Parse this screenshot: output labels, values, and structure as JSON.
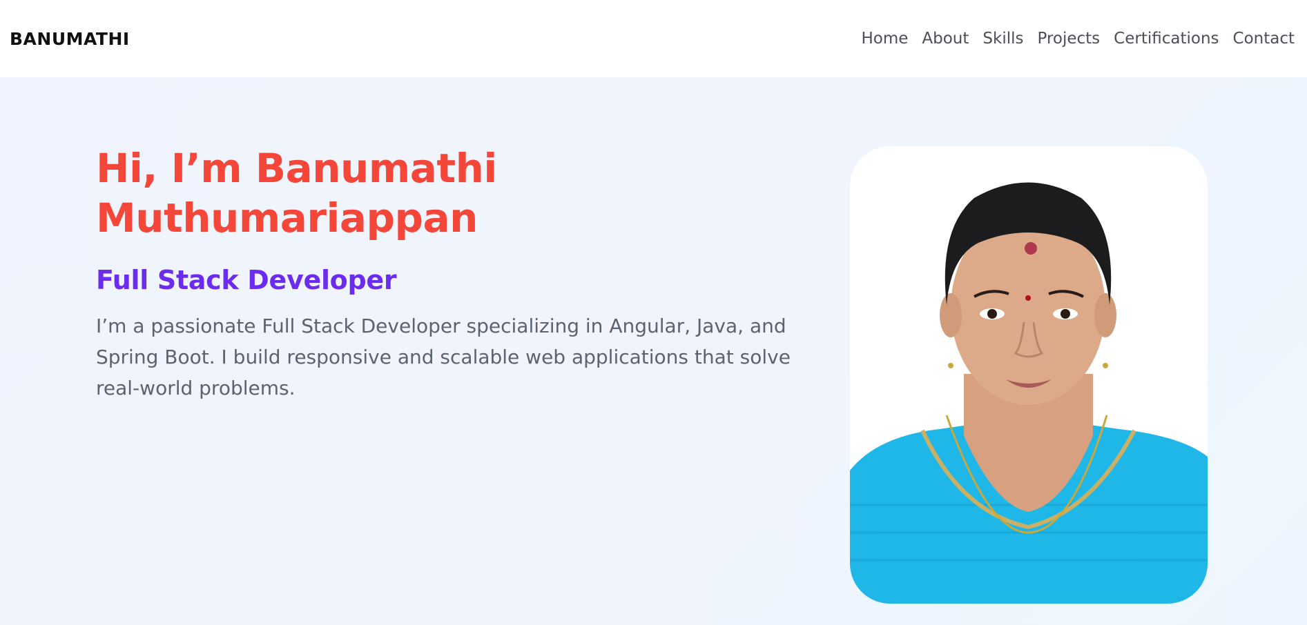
{
  "header": {
    "brand": "BANUMATHI",
    "nav": [
      {
        "label": "Home"
      },
      {
        "label": "About"
      },
      {
        "label": "Skills"
      },
      {
        "label": "Projects"
      },
      {
        "label": "Certifications"
      },
      {
        "label": "Contact"
      }
    ]
  },
  "hero": {
    "title_line1": "Hi, I’m Banumathi",
    "title_line2": "Muthumariappan",
    "role": "Full Stack Developer",
    "description": "I’m a passionate Full Stack Developer specializing in Angular, Java, and Spring Boot. I build responsive and scalable web applications that solve real-world problems."
  },
  "photo": {
    "icon": "profile-photo"
  },
  "colors": {
    "title": "#f4473a",
    "role": "#6b2cf0",
    "text": "#5b6270",
    "shirt": "#1fb6e8"
  }
}
